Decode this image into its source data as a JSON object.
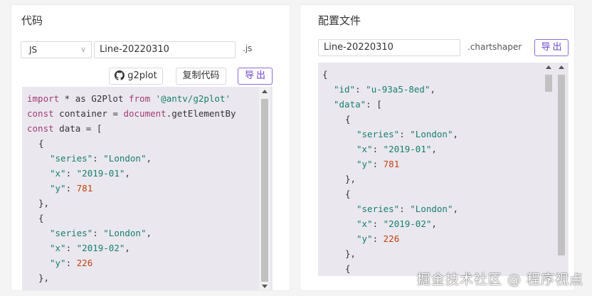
{
  "left": {
    "title": "代码",
    "language": "JS",
    "filename": "Line-20220310",
    "ext": ".js",
    "github_label": "g2plot",
    "copy_label": "复制代码",
    "export_label": "导出",
    "lines": [
      {
        "i": 0,
        "seg": [
          [
            "kw",
            "import"
          ],
          [
            "plain",
            " * as G2Plot "
          ],
          [
            "kw",
            "from"
          ],
          [
            "plain",
            " "
          ],
          [
            "str",
            "'@antv/g2plot'"
          ]
        ]
      },
      {
        "i": 0,
        "seg": [
          [
            "kw",
            "const"
          ],
          [
            "plain",
            " container = "
          ],
          [
            "kw",
            "document"
          ],
          [
            "plain",
            ".getElementBy"
          ]
        ]
      },
      {
        "i": 0,
        "seg": [
          [
            "kw",
            "const"
          ],
          [
            "plain",
            " data = ["
          ]
        ]
      },
      {
        "i": 1,
        "seg": [
          [
            "plain",
            "{"
          ]
        ]
      },
      {
        "i": 2,
        "seg": [
          [
            "str",
            "\"series\""
          ],
          [
            "plain",
            ": "
          ],
          [
            "str",
            "\"London\""
          ],
          [
            "plain",
            ","
          ]
        ]
      },
      {
        "i": 2,
        "seg": [
          [
            "str",
            "\"x\""
          ],
          [
            "plain",
            ": "
          ],
          [
            "str",
            "\"2019-01\""
          ],
          [
            "plain",
            ","
          ]
        ]
      },
      {
        "i": 2,
        "seg": [
          [
            "str",
            "\"y\""
          ],
          [
            "plain",
            ": "
          ],
          [
            "num",
            "781"
          ]
        ]
      },
      {
        "i": 1,
        "seg": [
          [
            "plain",
            "},"
          ]
        ]
      },
      {
        "i": 1,
        "seg": [
          [
            "plain",
            "{"
          ]
        ]
      },
      {
        "i": 2,
        "seg": [
          [
            "str",
            "\"series\""
          ],
          [
            "plain",
            ": "
          ],
          [
            "str",
            "\"London\""
          ],
          [
            "plain",
            ","
          ]
        ]
      },
      {
        "i": 2,
        "seg": [
          [
            "str",
            "\"x\""
          ],
          [
            "plain",
            ": "
          ],
          [
            "str",
            "\"2019-02\""
          ],
          [
            "plain",
            ","
          ]
        ]
      },
      {
        "i": 2,
        "seg": [
          [
            "str",
            "\"y\""
          ],
          [
            "plain",
            ": "
          ],
          [
            "num",
            "226"
          ]
        ]
      },
      {
        "i": 1,
        "seg": [
          [
            "plain",
            "},"
          ]
        ]
      }
    ]
  },
  "right": {
    "title": "配置文件",
    "filename": "Line-20220310",
    "ext": ".chartshaper",
    "export_label": "导出",
    "lines": [
      {
        "i": 0,
        "seg": [
          [
            "plain",
            "{"
          ]
        ]
      },
      {
        "i": 1,
        "seg": [
          [
            "str",
            "\"id\""
          ],
          [
            "plain",
            ": "
          ],
          [
            "str",
            "\"u-93a5-8ed\""
          ],
          [
            "plain",
            ","
          ]
        ]
      },
      {
        "i": 1,
        "seg": [
          [
            "str",
            "\"data\""
          ],
          [
            "plain",
            ": ["
          ]
        ]
      },
      {
        "i": 2,
        "seg": [
          [
            "plain",
            "{"
          ]
        ]
      },
      {
        "i": 3,
        "seg": [
          [
            "str",
            "\"series\""
          ],
          [
            "plain",
            ": "
          ],
          [
            "str",
            "\"London\""
          ],
          [
            "plain",
            ","
          ]
        ]
      },
      {
        "i": 3,
        "seg": [
          [
            "str",
            "\"x\""
          ],
          [
            "plain",
            ": "
          ],
          [
            "str",
            "\"2019-01\""
          ],
          [
            "plain",
            ","
          ]
        ]
      },
      {
        "i": 3,
        "seg": [
          [
            "str",
            "\"y\""
          ],
          [
            "plain",
            ": "
          ],
          [
            "num",
            "781"
          ]
        ]
      },
      {
        "i": 2,
        "seg": [
          [
            "plain",
            "},"
          ]
        ]
      },
      {
        "i": 2,
        "seg": [
          [
            "plain",
            "{"
          ]
        ]
      },
      {
        "i": 3,
        "seg": [
          [
            "str",
            "\"series\""
          ],
          [
            "plain",
            ": "
          ],
          [
            "str",
            "\"London\""
          ],
          [
            "plain",
            ","
          ]
        ]
      },
      {
        "i": 3,
        "seg": [
          [
            "str",
            "\"x\""
          ],
          [
            "plain",
            ": "
          ],
          [
            "str",
            "\"2019-02\""
          ],
          [
            "plain",
            ","
          ]
        ]
      },
      {
        "i": 3,
        "seg": [
          [
            "str",
            "\"y\""
          ],
          [
            "plain",
            ": "
          ],
          [
            "num",
            "226"
          ]
        ]
      },
      {
        "i": 2,
        "seg": [
          [
            "plain",
            "},"
          ]
        ]
      },
      {
        "i": 2,
        "seg": [
          [
            "plain",
            "{"
          ]
        ]
      }
    ]
  },
  "watermark": "掘金技术社区 @ 程序视点",
  "colors": {
    "accent": "#6f44c9",
    "code_bg": "#eae7ef",
    "keyword": "#a23b72",
    "string": "#17806d",
    "number": "#c2410c"
  }
}
